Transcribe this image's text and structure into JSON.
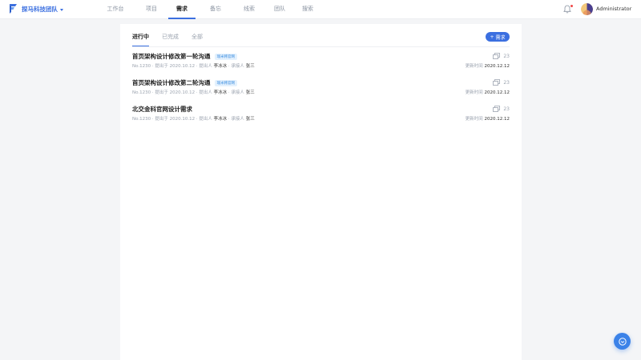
{
  "header": {
    "team_name": "探马科技团队",
    "nav": [
      {
        "label": "工作台",
        "active": false
      },
      {
        "label": "项目",
        "active": false
      },
      {
        "label": "需求",
        "active": true
      },
      {
        "label": "备忘",
        "active": false
      },
      {
        "label": "线索",
        "active": false
      },
      {
        "label": "团队",
        "active": false
      },
      {
        "label": "搜索",
        "active": false
      }
    ],
    "user_name": "Administrator",
    "has_notification": true
  },
  "tabs": [
    {
      "label": "进行中",
      "active": true
    },
    {
      "label": "已完成",
      "active": false
    },
    {
      "label": "全部",
      "active": false
    }
  ],
  "add_button": {
    "label": "需求",
    "icon": "plus-icon"
  },
  "requirements": [
    {
      "title": "首页架构设计修改第一轮沟通",
      "tag": "瑞米韩官网",
      "no": "No.1230",
      "proposed": "提出于 2020.10.12",
      "proposer_label": "提出人",
      "proposer": "李冰冰",
      "assignee_label": "承接人",
      "assignee": "张三",
      "count": "23",
      "updated_label": "更新时间",
      "updated": "2020.12.12"
    },
    {
      "title": "首页架构设计修改第二轮沟通",
      "tag": "瑞米韩官网",
      "no": "No.1230",
      "proposed": "提出于 2020.10.12",
      "proposer_label": "提出人",
      "proposer": "李冰冰",
      "assignee_label": "承接人",
      "assignee": "张三",
      "count": "23",
      "updated_label": "更新时间",
      "updated": "2020.12.12"
    },
    {
      "title": "北交金科官网设计需求",
      "tag": "",
      "no": "No.1230",
      "proposed": "提出于 2020.10.12",
      "proposer_label": "提出人",
      "proposer": "李冰冰",
      "assignee_label": "承接人",
      "assignee": "张三",
      "count": "23",
      "updated_label": "更新时间",
      "updated": "2020.12.12"
    }
  ],
  "colors": {
    "accent": "#3b6fe0",
    "tag_text": "#3b8ee0",
    "tag_bg": "#e4f1fd",
    "badge": "#f04848"
  }
}
